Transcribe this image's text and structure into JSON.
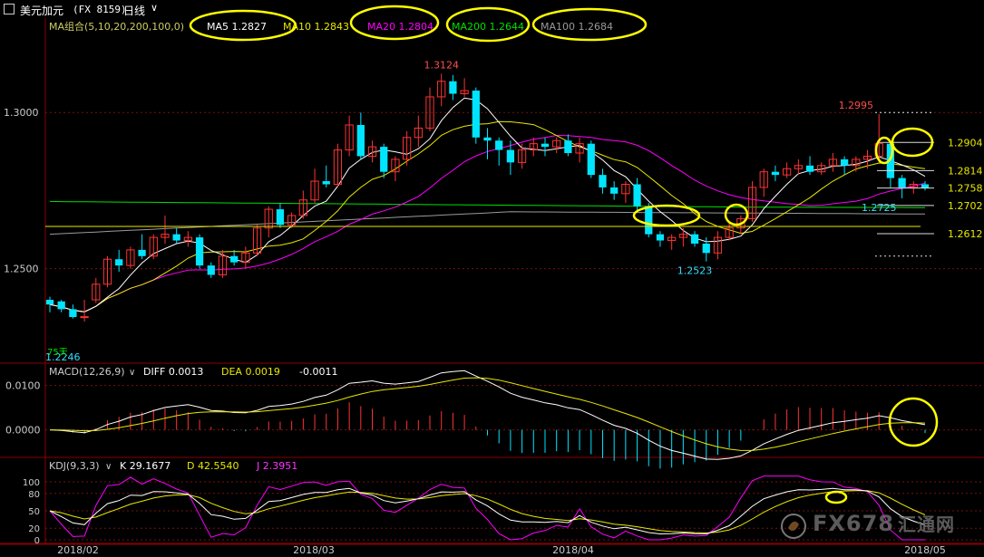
{
  "header": {
    "name": "美元加元",
    "code": "(FX 8159)",
    "period": "日线",
    "caret": "∨"
  },
  "chart_data": {
    "type": "candlestick",
    "price_axis": {
      "ticks": [
        "1.3000",
        "1.2500"
      ]
    },
    "ma_legend": {
      "label": "MA组合(5,10,20,200,100,0)",
      "items": [
        {
          "name": "MA5 1.2827",
          "color": "#ffffff"
        },
        {
          "name": "MA10 1.2843",
          "color": "#e8e800"
        },
        {
          "name": "MA20 1.2804",
          "color": "#ff00ff"
        },
        {
          "name": "MA200 1.2644",
          "color": "#00e000"
        },
        {
          "name": "MA100 1.2684",
          "color": "#9a9a9a"
        }
      ]
    },
    "candles": [
      [
        1.24,
        1.241,
        1.2385,
        1.236
      ],
      [
        1.2395,
        1.24,
        1.237,
        1.236
      ],
      [
        1.237,
        1.2385,
        1.2345,
        1.234
      ],
      [
        1.2346,
        1.24,
        1.2346,
        1.233
      ],
      [
        1.24,
        1.247,
        1.245,
        1.239
      ],
      [
        1.245,
        1.254,
        1.253,
        1.244
      ],
      [
        1.253,
        1.256,
        1.251,
        1.249
      ],
      [
        1.251,
        1.257,
        1.256,
        1.25
      ],
      [
        1.256,
        1.261,
        1.254,
        1.253
      ],
      [
        1.254,
        1.261,
        1.26,
        1.253
      ],
      [
        1.26,
        1.267,
        1.261,
        1.258
      ],
      [
        1.261,
        1.263,
        1.259,
        1.258
      ],
      [
        1.259,
        1.262,
        1.26,
        1.257
      ],
      [
        1.26,
        1.261,
        1.251,
        1.25
      ],
      [
        1.251,
        1.252,
        1.248,
        1.247
      ],
      [
        1.248,
        1.256,
        1.254,
        1.247
      ],
      [
        1.254,
        1.256,
        1.252,
        1.251
      ],
      [
        1.252,
        1.257,
        1.255,
        1.25
      ],
      [
        1.255,
        1.264,
        1.263,
        1.254
      ],
      [
        1.263,
        1.27,
        1.269,
        1.26
      ],
      [
        1.269,
        1.271,
        1.264,
        1.263
      ],
      [
        1.264,
        1.268,
        1.267,
        1.263
      ],
      [
        1.267,
        1.275,
        1.272,
        1.266
      ],
      [
        1.272,
        1.282,
        1.278,
        1.271
      ],
      [
        1.278,
        1.283,
        1.277,
        1.276
      ],
      [
        1.277,
        1.29,
        1.288,
        1.276
      ],
      [
        1.288,
        1.299,
        1.296,
        1.286
      ],
      [
        1.296,
        1.3,
        1.286,
        1.285
      ],
      [
        1.286,
        1.291,
        1.289,
        1.284
      ],
      [
        1.289,
        1.29,
        1.281,
        1.279
      ],
      [
        1.281,
        1.286,
        1.285,
        1.278
      ],
      [
        1.285,
        1.294,
        1.292,
        1.283
      ],
      [
        1.292,
        1.299,
        1.295,
        1.289
      ],
      [
        1.295,
        1.308,
        1.305,
        1.294
      ],
      [
        1.305,
        1.3124,
        1.31,
        1.302
      ],
      [
        1.31,
        1.312,
        1.306,
        1.304
      ],
      [
        1.306,
        1.311,
        1.307,
        1.305
      ],
      [
        1.307,
        1.308,
        1.292,
        1.29
      ],
      [
        1.292,
        1.295,
        1.291,
        1.285
      ],
      [
        1.291,
        1.292,
        1.288,
        1.283
      ],
      [
        1.288,
        1.291,
        1.284,
        1.28
      ],
      [
        1.284,
        1.29,
        1.288,
        1.282
      ],
      [
        1.288,
        1.292,
        1.29,
        1.286
      ],
      [
        1.29,
        1.292,
        1.289,
        1.286
      ],
      [
        1.289,
        1.292,
        1.291,
        1.287
      ],
      [
        1.291,
        1.293,
        1.287,
        1.286
      ],
      [
        1.287,
        1.292,
        1.29,
        1.284
      ],
      [
        1.29,
        1.291,
        1.28,
        1.279
      ],
      [
        1.28,
        1.282,
        1.276,
        1.274
      ],
      [
        1.276,
        1.278,
        1.274,
        1.272
      ],
      [
        1.274,
        1.278,
        1.277,
        1.271
      ],
      [
        1.277,
        1.279,
        1.27,
        1.268
      ],
      [
        1.27,
        1.271,
        1.261,
        1.26
      ],
      [
        1.261,
        1.262,
        1.259,
        1.257
      ],
      [
        1.259,
        1.261,
        1.26,
        1.256
      ],
      [
        1.26,
        1.263,
        1.261,
        1.257
      ],
      [
        1.261,
        1.262,
        1.258,
        1.257
      ],
      [
        1.258,
        1.26,
        1.255,
        1.2523
      ],
      [
        1.255,
        1.262,
        1.26,
        1.253
      ],
      [
        1.26,
        1.265,
        1.263,
        1.259
      ],
      [
        1.263,
        1.267,
        1.266,
        1.261
      ],
      [
        1.266,
        1.278,
        1.276,
        1.265
      ],
      [
        1.276,
        1.282,
        1.281,
        1.273
      ],
      [
        1.281,
        1.283,
        1.28,
        1.278
      ],
      [
        1.28,
        1.284,
        1.282,
        1.279
      ],
      [
        1.282,
        1.285,
        1.283,
        1.28
      ],
      [
        1.283,
        1.286,
        1.281,
        1.28
      ],
      [
        1.281,
        1.284,
        1.283,
        1.28
      ],
      [
        1.283,
        1.287,
        1.285,
        1.281
      ],
      [
        1.285,
        1.286,
        1.283,
        1.28
      ],
      [
        1.283,
        1.286,
        1.285,
        1.281
      ],
      [
        1.285,
        1.288,
        1.286,
        1.282
      ],
      [
        1.286,
        1.2995,
        1.29,
        1.284
      ],
      [
        1.29,
        1.291,
        1.279,
        1.276
      ],
      [
        1.279,
        1.28,
        1.276,
        1.2725
      ],
      [
        1.276,
        1.278,
        1.277,
        1.274
      ],
      [
        1.277,
        1.278,
        1.2758,
        1.275
      ]
    ],
    "price_labels": [
      "1.3124",
      "1.2995",
      "1.2523",
      "1.2725",
      "1.2246"
    ],
    "side_levels": [
      {
        "label": "1.2904",
        "value": 1.2904,
        "color": "#e8e800"
      },
      {
        "label": "1.2814",
        "value": 1.2814,
        "color": "#e8e800"
      },
      {
        "label": "1.2758",
        "value": 1.2758,
        "color": "#e8e800"
      },
      {
        "label": "1.2702",
        "value": 1.2702,
        "color": "#e8e800"
      },
      {
        "label": "1.2612",
        "value": 1.2612,
        "color": "#e8e800"
      }
    ],
    "corner_label": "75天",
    "macd": {
      "label": "MACD(12,26,9)",
      "caret": "∨",
      "diff": "DIFF 0.0013",
      "dea": "DEA 0.0019",
      "macd": "-0.0011",
      "ticks": [
        "0.0100",
        "0.0000"
      ]
    },
    "kdj": {
      "label": "KDJ(9,3,3)",
      "caret": "∨",
      "k": "K 29.1677",
      "d": "D 42.5540",
      "j": "J 2.3951",
      "ticks": [
        "100",
        "80",
        "50",
        "20",
        "0"
      ]
    },
    "x_labels": [
      "2018/02",
      "2018/03",
      "2018/04",
      "2018/05"
    ]
  },
  "watermark": "FX678",
  "watermark_suffix": "汇通网",
  "colors": {
    "up": "#ff3333",
    "down": "#00e5ff",
    "ma5": "#ffffff",
    "ma10": "#e8e800",
    "ma20": "#ff00ff",
    "ma200": "#00e000",
    "ma100": "#9a9a9a",
    "annot": "#ffff00"
  }
}
